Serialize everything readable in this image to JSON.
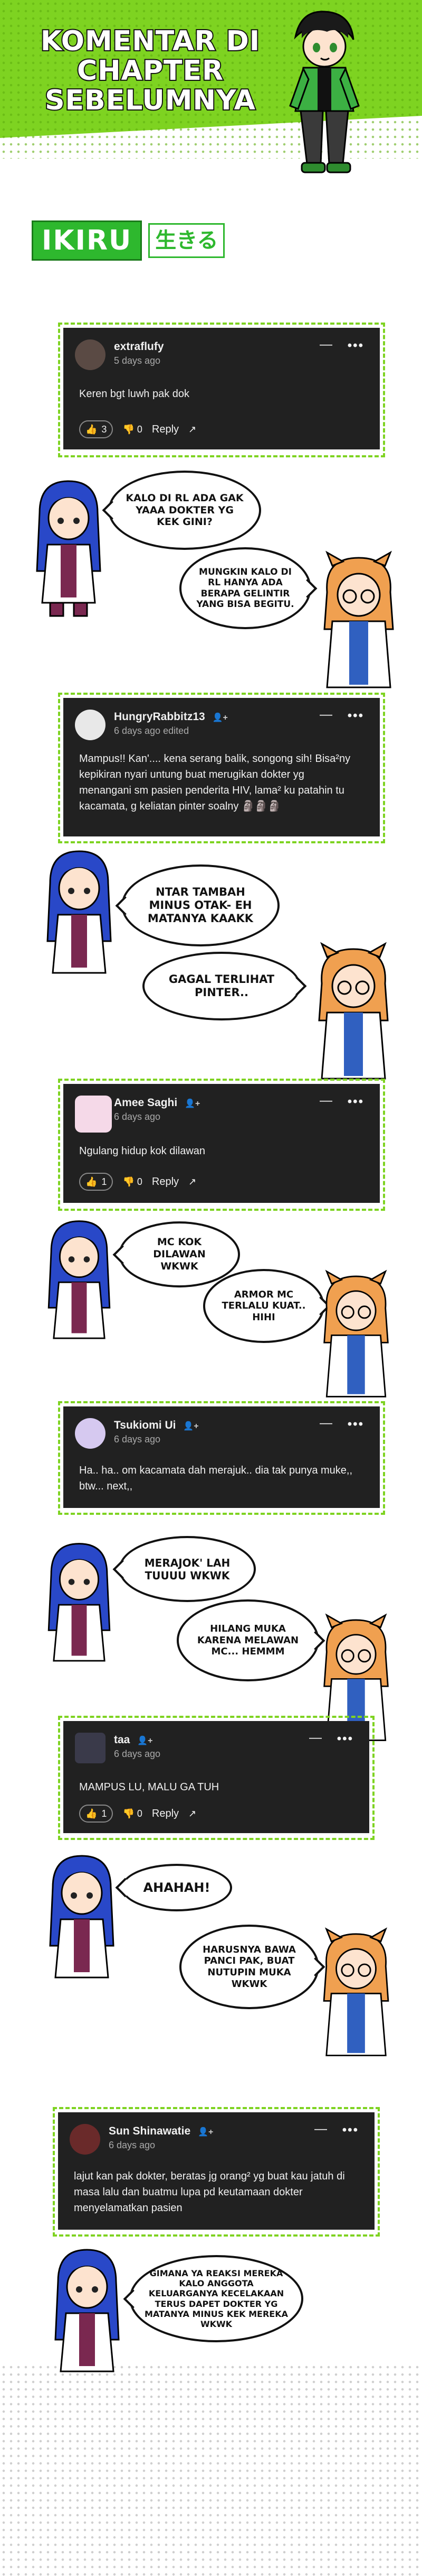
{
  "header": {
    "title_line1": "KOMENTAR DI",
    "title_line2": "CHAPTER",
    "title_line3": "SEBELUMNYA",
    "logo_main": "IKIRU",
    "logo_sub": "生きる",
    "accent": "#7ed321"
  },
  "comments": [
    {
      "username": "extraflufy",
      "meta": "5 days ago",
      "text": "Keren bgt luwh pak dok",
      "likes": "3",
      "dislikes": "0",
      "reply": "Reply"
    },
    {
      "username": "HungryRabbitz13",
      "meta": "6 days ago   edited",
      "text": "Mampus!! Kan'.... kena serang balik, songong sih! Bisa²ny kepikiran nyari untung buat merugikan dokter yg menangani sm pasien penderita HIV, lama² ku patahin tu kacamata, g keliatan pinter soalny 🗿🗿🗿"
    },
    {
      "username": "Amee Saghi",
      "meta": "6 days ago",
      "text": "Ngulang hidup kok dilawan",
      "likes": "1",
      "dislikes": "0",
      "reply": "Reply"
    },
    {
      "username": "Tsukiomi Ui",
      "meta": "6 days ago",
      "text": "Ha.. ha.. om kacamata dah merajuk.. dia tak punya muke,, btw... next,,"
    },
    {
      "username": "taa",
      "meta": "6 days ago",
      "text": "MAMPUS LU, MALU GA TUH",
      "likes": "1",
      "dislikes": "0",
      "reply": "Reply"
    },
    {
      "username": "Sun Shinawatie",
      "meta": "6 days ago",
      "text": "lajut kan pak dokter, beratas jg orang² yg buat kau jatuh di masa lalu dan buatmu lupa pd keutamaan dokter menyelamatkan pasien"
    }
  ],
  "bubbles": {
    "b1": "KALO DI RL ADA GAK YAAA DOKTER YG KEK GINI?",
    "b2": "MUNGKIN KALO DI RL HANYA ADA BERAPA GELINTIR YANG BISA BEGITU.",
    "b3": "NTAR TAMBAH MINUS OTAK- EH MATANYA KAAKK",
    "b4": "GAGAL TERLIHAT PINTER..",
    "b5": "MC KOK DILAWAN WKWK",
    "b6": "ARMOR MC TERLALU KUAT.. HIHI",
    "b7": "MERAJOK' LAH TUUUU WKWK",
    "b8": "HILANG MUKA KARENA MELAWAN MC... HEMMM",
    "b9": "AHAHAH!",
    "b10": "HARUSNYA BAWA PANCI PAK, BUAT NUTUPIN MUKA WKWK",
    "b11": "GIMANA YA REAKSI MEREKA KALO ANGGOTA KELUARGANYA KECELAKAAN TERUS DAPET DOKTER YG MATANYA MINUS KEK MEREKA WKWK"
  }
}
